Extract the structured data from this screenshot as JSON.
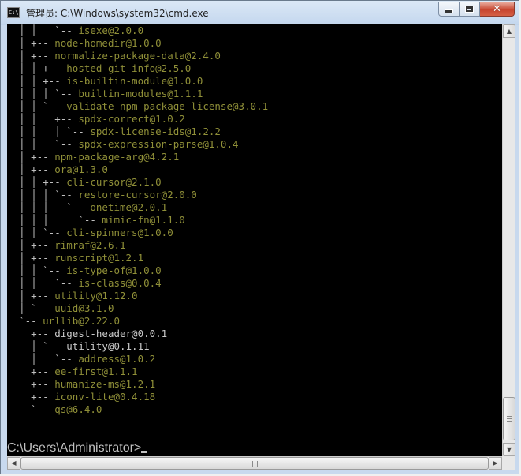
{
  "window": {
    "title": "管理员: C:\\Windows\\system32\\cmd.exe",
    "icon": "cmd-icon",
    "icon_text": "C:\\"
  },
  "caption_buttons": {
    "minimize_icon": "minimize-icon",
    "maximize_icon": "maximize-icon",
    "close_icon": "close-icon",
    "close_glyph": "✕"
  },
  "console": {
    "lines": [
      {
        "tree": "  │ │   `-- ",
        "pkg": "isexe@2.0.0"
      },
      {
        "tree": "  │ +-- ",
        "pkg": "node-homedir@1.0.0"
      },
      {
        "tree": "  │ +-- ",
        "pkg": "normalize-package-data@2.4.0"
      },
      {
        "tree": "  │ │ +-- ",
        "pkg": "hosted-git-info@2.5.0"
      },
      {
        "tree": "  │ │ +-- ",
        "pkg": "is-builtin-module@1.0.0"
      },
      {
        "tree": "  │ │ │ `-- ",
        "pkg": "builtin-modules@1.1.1"
      },
      {
        "tree": "  │ │ `-- ",
        "pkg": "validate-npm-package-license@3.0.1"
      },
      {
        "tree": "  │ │   +-- ",
        "pkg": "spdx-correct@1.0.2"
      },
      {
        "tree": "  │ │   │ `-- ",
        "pkg": "spdx-license-ids@1.2.2"
      },
      {
        "tree": "  │ │   `-- ",
        "pkg": "spdx-expression-parse@1.0.4"
      },
      {
        "tree": "  │ +-- ",
        "pkg": "npm-package-arg@4.2.1"
      },
      {
        "tree": "  │ +-- ",
        "pkg": "ora@1.3.0"
      },
      {
        "tree": "  │ │ +-- ",
        "pkg": "cli-cursor@2.1.0"
      },
      {
        "tree": "  │ │ │ `-- ",
        "pkg": "restore-cursor@2.0.0"
      },
      {
        "tree": "  │ │ │   `-- ",
        "pkg": "onetime@2.0.1"
      },
      {
        "tree": "  │ │ │     `-- ",
        "pkg": "mimic-fn@1.1.0"
      },
      {
        "tree": "  │ │ `-- ",
        "pkg": "cli-spinners@1.0.0"
      },
      {
        "tree": "  │ +-- ",
        "pkg": "rimraf@2.6.1"
      },
      {
        "tree": "  │ +-- ",
        "pkg": "runscript@1.2.1"
      },
      {
        "tree": "  │ │ `-- ",
        "pkg": "is-type-of@1.0.0"
      },
      {
        "tree": "  │ │   `-- ",
        "pkg": "is-class@0.0.4"
      },
      {
        "tree": "  │ +-- ",
        "pkg": "utility@1.12.0"
      },
      {
        "tree": "  │ `-- ",
        "pkg": "uuid@3.1.0"
      },
      {
        "tree": "  `-- ",
        "pkg": "urllib@2.22.0"
      },
      {
        "tree": "    +-- ",
        "pkg": "digest-header@0.0.1",
        "white": true
      },
      {
        "tree": "    │ `-- ",
        "pkg": "utility@0.1.11",
        "white": true
      },
      {
        "tree": "    │   `-- ",
        "pkg": "address@1.0.2"
      },
      {
        "tree": "    +-- ",
        "pkg": "ee-first@1.1.1"
      },
      {
        "tree": "    +-- ",
        "pkg": "humanize-ms@1.2.1"
      },
      {
        "tree": "    +-- ",
        "pkg": "iconv-lite@0.4.18"
      },
      {
        "tree": "    `-- ",
        "pkg": "qs@6.4.0"
      },
      {
        "tree": "",
        "pkg": ""
      },
      {
        "tree": "",
        "pkg": ""
      }
    ],
    "prompt": "C:\\Users\\Administrator>",
    "text_color": "#c0c0c0",
    "package_color": "#8f8f38",
    "background": "#000000"
  },
  "scrollbars": {
    "up_arrow": "▲",
    "down_arrow": "▼",
    "left_arrow": "◀",
    "right_arrow": "▶"
  }
}
